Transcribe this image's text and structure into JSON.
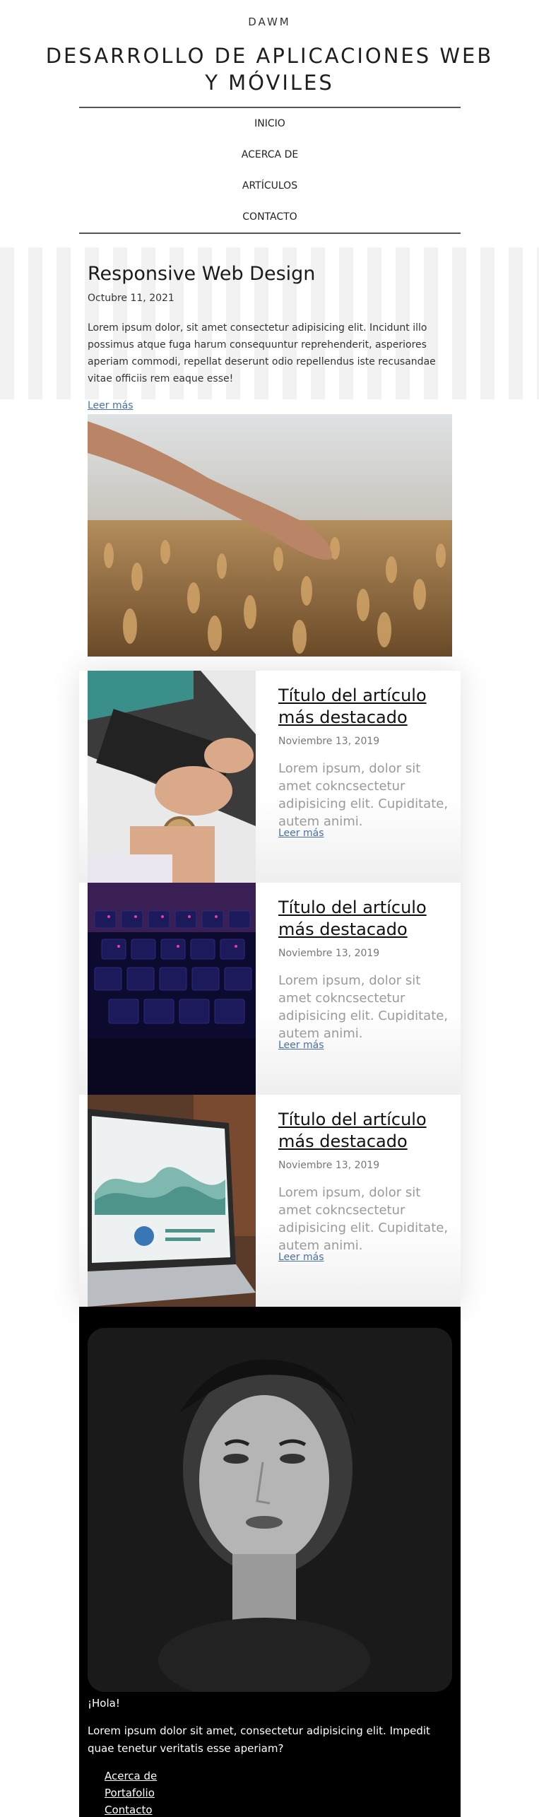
{
  "header": {
    "brand": "DAWM",
    "title": "DESARROLLO DE APLICACIONES WEB Y MÓVILES",
    "nav": [
      {
        "label": "INICIO"
      },
      {
        "label": "ACERCA DE"
      },
      {
        "label": "ARTÍCULOS"
      },
      {
        "label": "CONTACTO"
      }
    ]
  },
  "featured": {
    "title": "Responsive Web Design",
    "date": "Octubre 11, 2021",
    "excerpt": "Lorem ipsum dolor, sit amet consectetur adipisicing elit. Incidunt illo possimus atque fuga harum consequuntur reprehenderit, asperiores aperiam commodi, repellat deserunt odio repellendus iste recusandae vitae officiis rem eaque esse!",
    "link": "Leer más"
  },
  "articles": [
    {
      "title": "Título del artículo más destacado",
      "date": "Noviembre 13, 2019",
      "text": "Lorem ipsum, dolor sit amet cokncsectetur adipisicing elit. Cupiditate, autem animi.",
      "link": "Leer más"
    },
    {
      "title": "Título del artículo más destacado",
      "date": "Noviembre 13, 2019",
      "text": "Lorem ipsum, dolor sit amet cokncsectetur adipisicing elit. Cupiditate, autem animi.",
      "link": "Leer más"
    },
    {
      "title": "Título del artículo más destacado",
      "date": "Noviembre 13, 2019",
      "text": "Lorem ipsum, dolor sit amet cokncsectetur adipisicing elit. Cupiditate, autem animi.",
      "link": "Leer más"
    }
  ],
  "about": {
    "greeting": "¡Hola!",
    "text": "Lorem ipsum dolor sit amet, consectetur adipisicing elit. Impedit quae tenetur veritatis esse aperiam?",
    "links": [
      {
        "label": "Acerca de"
      },
      {
        "label": "Portafolio"
      },
      {
        "label": "Contacto"
      }
    ]
  }
}
